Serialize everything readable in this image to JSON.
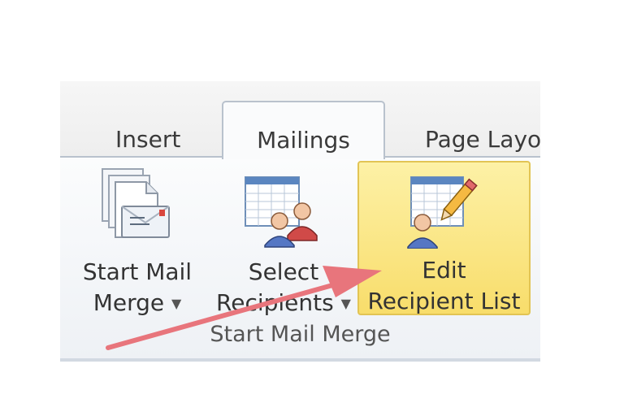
{
  "tabs": {
    "insert": "Insert",
    "mailings": "Mailings",
    "page_layout": "Page Layo"
  },
  "group": {
    "label": "Start Mail Merge",
    "buttons": {
      "start_mail_merge": {
        "line1": "Start Mail",
        "line2": "Merge",
        "icon": "start-mail-merge-icon",
        "dropdown": true
      },
      "select_recipients": {
        "line1": "Select",
        "line2": "Recipients",
        "icon": "select-recipients-icon",
        "dropdown": true
      },
      "edit_recipient_list": {
        "line1": "Edit",
        "line2": "Recipient List",
        "icon": "edit-recipient-list-icon",
        "highlighted": true
      }
    }
  },
  "annotation": {
    "color": "#e8757c",
    "icon": "arrow-annotation"
  },
  "colors": {
    "highlight": "#f8dd6b",
    "tab_border": "#b9c2cd"
  }
}
